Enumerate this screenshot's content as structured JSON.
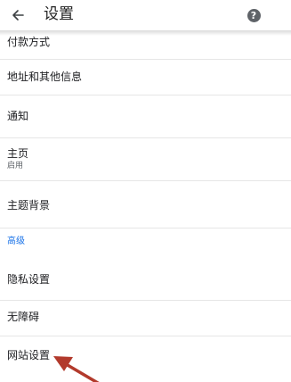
{
  "appbar": {
    "title": "设置",
    "back_icon": "arrow-left-icon",
    "help_icon": "help-circle-icon",
    "help_glyph": "?"
  },
  "settings": {
    "payment_methods": "付款方式",
    "addresses": "地址和其他信息",
    "notifications": "通知",
    "homepage": {
      "label": "主页",
      "status": "启用"
    },
    "theme": "主题背景",
    "advanced_header": "高级",
    "privacy": "隐私设置",
    "accessibility": "无障碍",
    "site_settings": "网站设置"
  },
  "colors": {
    "accent": "#1a73e8",
    "annotation_arrow": "#b23a2c"
  }
}
